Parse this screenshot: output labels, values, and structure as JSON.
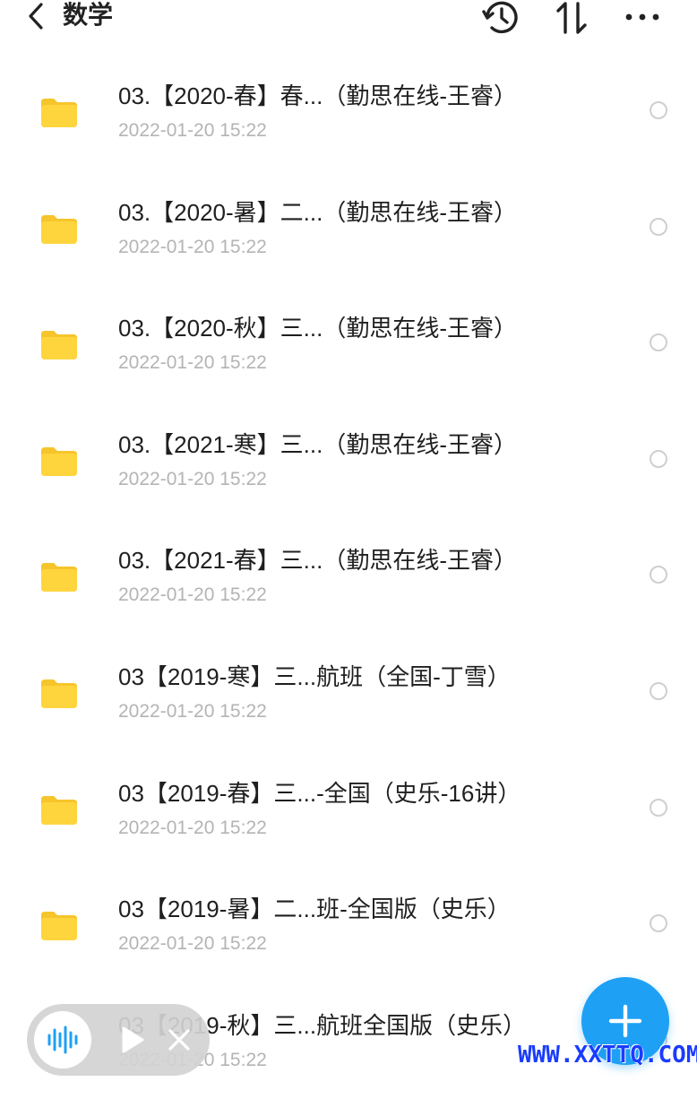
{
  "header": {
    "title": "数学",
    "back_icon": "chevron-left-icon",
    "history_icon": "history-icon",
    "sort_icon": "sort-icon",
    "more_icon": "more-horizontal-icon"
  },
  "colors": {
    "folder": "#FFD53E",
    "folder_tab": "#F6C52B",
    "fab": "#1EA0F5",
    "date_text": "#B4B4B4",
    "radio_border": "#CFCFCF",
    "watermark": "#1A3CFF"
  },
  "files": [
    {
      "name": "03.【2020-春】春...（勤思在线-王睿）",
      "date": "2022-01-20 15:22"
    },
    {
      "name": "03.【2020-暑】二...（勤思在线-王睿）",
      "date": "2022-01-20 15:22"
    },
    {
      "name": "03.【2020-秋】三...（勤思在线-王睿）",
      "date": "2022-01-20 15:22"
    },
    {
      "name": "03.【2021-寒】三...（勤思在线-王睿）",
      "date": "2022-01-20 15:22"
    },
    {
      "name": "03.【2021-春】三...（勤思在线-王睿）",
      "date": "2022-01-20 15:22"
    },
    {
      "name": "03【2019-寒】三...航班（全国-丁雪）",
      "date": "2022-01-20 15:22"
    },
    {
      "name": "03【2019-春】三...-全国（史乐-16讲）",
      "date": "2022-01-20 15:22"
    },
    {
      "name": "03【2019-暑】二...班-全国版（史乐）",
      "date": "2022-01-20 15:22"
    },
    {
      "name": "03【2019-秋】三...航班全国版（史乐）",
      "date": "2022-01-20 15:22"
    }
  ],
  "player": {
    "audio_icon": "audio-wave-icon",
    "play_icon": "play-icon",
    "close_icon": "close-icon"
  },
  "fab": {
    "icon": "plus-icon"
  },
  "watermark": "WWW.XXTTQ.COM"
}
